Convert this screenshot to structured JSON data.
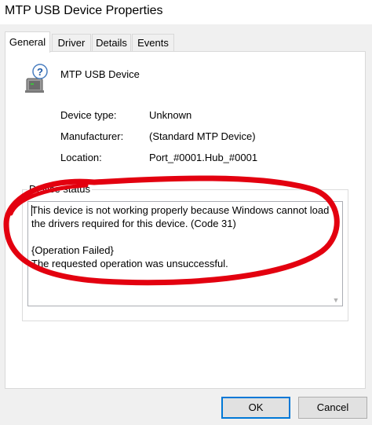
{
  "window": {
    "title": "MTP USB Device Properties"
  },
  "tabs": [
    {
      "label": "General",
      "active": true
    },
    {
      "label": "Driver",
      "active": false
    },
    {
      "label": "Details",
      "active": false
    },
    {
      "label": "Events",
      "active": false
    }
  ],
  "device": {
    "icon": "usb-device-question-icon",
    "name": "MTP USB Device"
  },
  "properties": [
    {
      "label": "Device type:",
      "value": "Unknown"
    },
    {
      "label": "Manufacturer:",
      "value": "(Standard MTP Device)"
    },
    {
      "label": "Location:",
      "value": "Port_#0001.Hub_#0001"
    }
  ],
  "status": {
    "group_title": "Device status",
    "lines": [
      "This device is not working properly because Windows cannot load",
      "the drivers required for this device. (Code 31)",
      "",
      "{Operation Failed}",
      "The requested operation was unsuccessful."
    ]
  },
  "buttons": {
    "ok": "OK",
    "cancel": "Cancel"
  },
  "colors": {
    "annotation": "#e3000f",
    "accent": "#0078d7"
  }
}
